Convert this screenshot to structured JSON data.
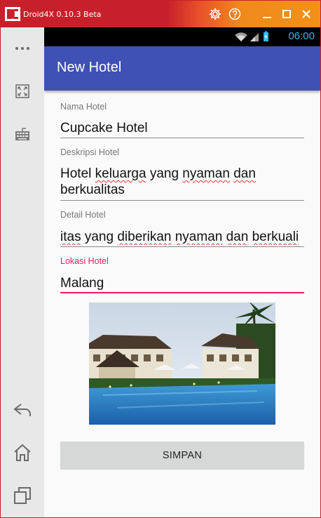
{
  "emulator": {
    "title": "Droid4X 0.10.3 Beta",
    "controls": [
      "gear-icon",
      "help-icon",
      "minimize-icon",
      "maximize-icon",
      "close-icon"
    ]
  },
  "sidebar": {
    "items": [
      "more-icon",
      "fullscreen-icon",
      "keyboard-icon",
      "back-icon",
      "home-icon",
      "recent-apps-icon"
    ]
  },
  "statusbar": {
    "time": "06:00",
    "icons": [
      "wifi-icon",
      "signal-icon",
      "battery-charging-icon"
    ]
  },
  "appbar": {
    "title": "New Hotel"
  },
  "form": {
    "nama": {
      "label": "Nama Hotel",
      "value": "Cupcake Hotel"
    },
    "deskripsi": {
      "label": "Deskripsi Hotel",
      "value": "Hotel keluarga yang nyaman dan berkualitas"
    },
    "detail": {
      "label": "Detail Hotel",
      "value": "itas yang diberikan nyaman dan berkuali"
    },
    "lokasi": {
      "label": "Lokasi Hotel",
      "value": "Malang"
    },
    "save_label": "SIMPAN"
  },
  "colors": {
    "accent": "#e91e63",
    "primary": "#3f51b5",
    "title_bar_start": "#c8202a",
    "title_bar_end": "#f49018"
  }
}
